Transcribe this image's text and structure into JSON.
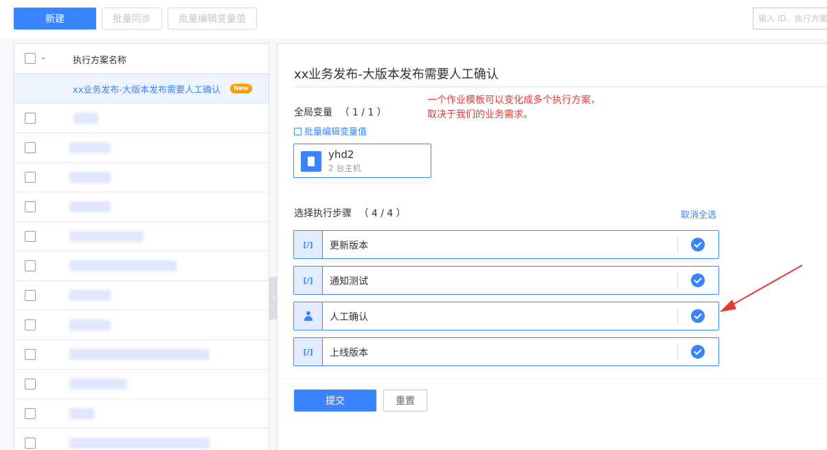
{
  "toolbar": {
    "new_label": "新建",
    "batch_sync_label": "批量同步",
    "batch_edit_label": "批量编辑变量值",
    "search_placeholder": "输入 ID、执行方案名称"
  },
  "plan_list": {
    "header_label": "执行方案名称",
    "selected": {
      "name": "xx业务发布-大版本发布需要人工确认",
      "badge": "New"
    },
    "blurred_rows": 12
  },
  "detail": {
    "title": "xx业务发布-大版本发布需要人工确认",
    "annotation": [
      "一个作业模板可以变化成多个执行方案，",
      "取决于我们的业务需求。"
    ],
    "global_vars": {
      "label": "全局变量",
      "count": "（ 1 / 1 ）",
      "batch_edit_link": "批量编辑变量值"
    },
    "host_var": {
      "name": "yhd2",
      "hosts": "2 台主机"
    },
    "steps": {
      "label": "选择执行步骤",
      "count": "（ 4 / 4 ）",
      "deselect_all": "取消全选",
      "items": [
        {
          "name": "更新版本",
          "icon": "script-icon",
          "icon_text": "[/]",
          "checked": true
        },
        {
          "name": "通知测试",
          "icon": "script-icon",
          "icon_text": "[/]",
          "checked": true
        },
        {
          "name": "人工确认",
          "icon": "person-icon",
          "icon_text": "",
          "checked": true
        },
        {
          "name": "上线版本",
          "icon": "script-icon",
          "icon_text": "[/]",
          "checked": true
        }
      ]
    }
  },
  "footer": {
    "submit_label": "提交",
    "reset_label": "重置"
  },
  "colors": {
    "primary": "#3a84ff",
    "annotation": "#ea3636",
    "new_badge": "#ff9c01"
  }
}
